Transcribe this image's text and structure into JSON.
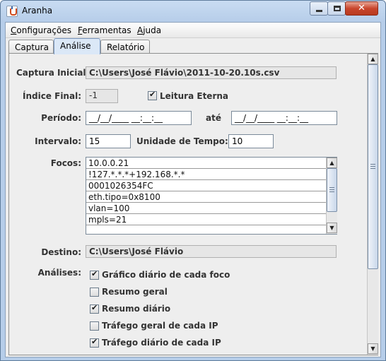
{
  "window": {
    "title": "Aranha",
    "close_label": "✕"
  },
  "menu": {
    "items": [
      {
        "pre": "",
        "mn": "C",
        "post": "onfigurações"
      },
      {
        "pre": "",
        "mn": "F",
        "post": "erramentas"
      },
      {
        "pre": "",
        "mn": "A",
        "post": "juda"
      }
    ]
  },
  "tabs": [
    "Captura",
    "Análise",
    "Relatório"
  ],
  "active_tab": "Análise",
  "form": {
    "captura_inicial_label": "Captura Inicial:",
    "captura_inicial_value": "C:\\Users\\José Flávio\\2011-10-20.10s.csv",
    "indice_final_label": "Índice Final:",
    "indice_final_value": "-1",
    "leitura_eterna_label": "Leitura Eterna",
    "leitura_eterna_checked": true,
    "periodo_label": "Período:",
    "periodo_start": "__/__/____ __:__:__",
    "ate_label": "até",
    "periodo_end": "__/__/____ __:__:__",
    "intervalo_label": "Intervalo:",
    "intervalo_value": "15",
    "unidade_label": "Unidade de Tempo:",
    "unidade_value": "10",
    "focos_label": "Focos:",
    "focos": [
      "10.0.0.21",
      "!127.*.*.*+192.168.*.*",
      "0001026354FC",
      "eth.tipo=0x8100",
      "vlan=100",
      "mpls=21"
    ],
    "destino_label": "Destino:",
    "destino_value": "C:\\Users\\José Flávio",
    "analises_label": "Análises:",
    "analises": [
      {
        "label": "Gráfico diário de cada foco",
        "checked": true
      },
      {
        "label": "Resumo geral",
        "checked": false
      },
      {
        "label": "Resumo diário",
        "checked": true
      },
      {
        "label": "Tráfego geral de cada IP",
        "checked": false
      },
      {
        "label": "Tráfego diário de cada IP",
        "checked": true
      }
    ]
  },
  "icons": {
    "app": "spider-app-icon",
    "scroll_up": "▲",
    "scroll_down": "▼"
  }
}
